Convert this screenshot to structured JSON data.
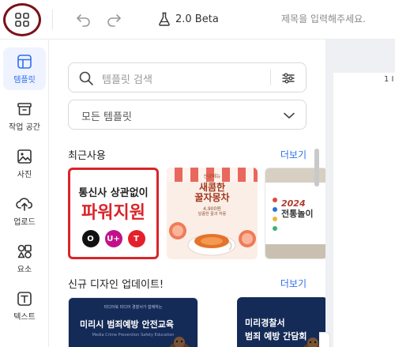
{
  "header": {
    "menu_icon": "grid-icon",
    "undo_icon": "undo-icon",
    "redo_icon": "redo-icon",
    "version_icon": "flask-icon",
    "version_label": "2.0 Beta",
    "title_placeholder": "제목을 입력해주세요."
  },
  "rail": {
    "items": [
      {
        "label": "템플릿",
        "icon": "template-icon",
        "active": true
      },
      {
        "label": "작업 공간",
        "icon": "archive-icon",
        "active": false
      },
      {
        "label": "사진",
        "icon": "image-icon",
        "active": false
      },
      {
        "label": "업로드",
        "icon": "cloud-upload-icon",
        "active": false
      },
      {
        "label": "요소",
        "icon": "shapes-icon",
        "active": false
      },
      {
        "label": "텍스트",
        "icon": "text-icon",
        "active": false
      }
    ]
  },
  "panel": {
    "search_placeholder": "템플릿 검색",
    "select_value": "모든 템플릿",
    "recent": {
      "title": "최근사용",
      "more": "더보기",
      "cards": [
        {
          "line1": "통신사 상관없이",
          "line2": "파워지원",
          "logos": [
            "O",
            "U+",
            "T"
          ]
        },
        {
          "sub": "신규메뉴",
          "title_a": "새콤한",
          "title_b": "꿀자몽차",
          "price": "4,900원",
          "small": "달콤한 꿀과 자몽"
        },
        {
          "title_a": "2024",
          "title_b": "전통놀이"
        }
      ]
    },
    "new_designs": {
      "title": "신규 디자인 업데이트!",
      "more": "더보기",
      "cards": [
        {
          "tiny": "미디어북 미디어 경찰서가 함께하는",
          "big": "미리시 범죄예방 안전교육",
          "sub": "Media Crime Prevention Safety Education"
        },
        {
          "big_a": "미리경찰서",
          "big_b": "범죄 예방 간담회"
        }
      ]
    }
  },
  "canvas": {
    "page_number": "1 I"
  },
  "colors": {
    "accent": "#2f6fed",
    "menu_ring": "#7a1218",
    "card_red": "#d9252b",
    "navy": "#152b57"
  }
}
